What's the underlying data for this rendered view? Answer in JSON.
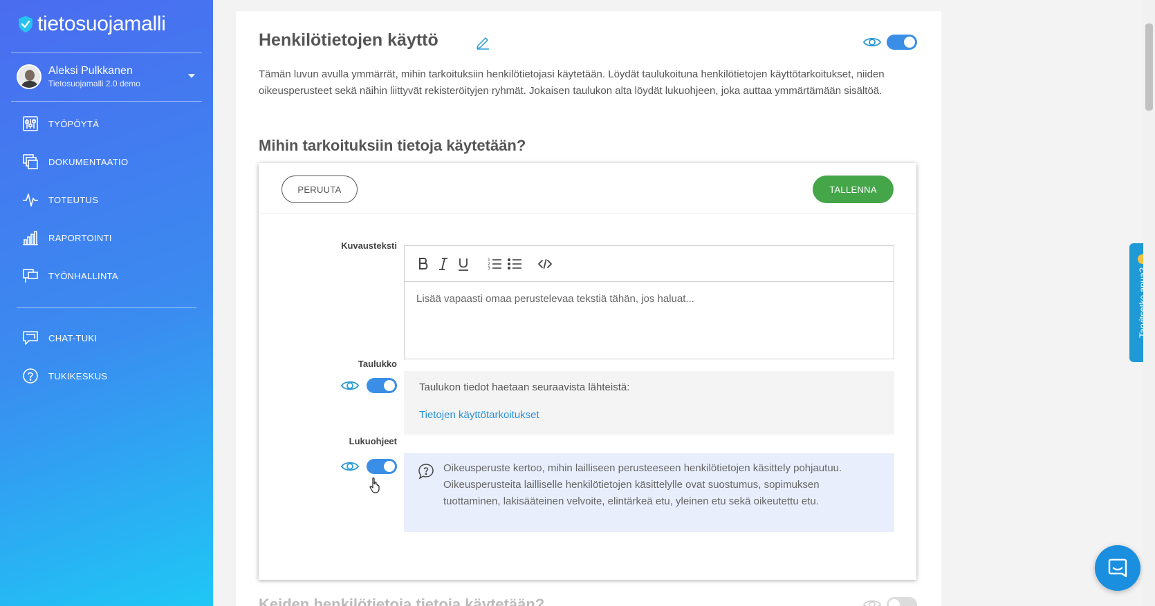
{
  "app": {
    "logo_text": "tietosuojamalli"
  },
  "user": {
    "name": "Aleksi Pulkkanen",
    "subtitle": "Tietosuojamalli 2.0 demo"
  },
  "nav": {
    "items": [
      {
        "label": "TYÖPÖYTÄ",
        "icon": "dashboard-icon"
      },
      {
        "label": "DOKUMENTAATIO",
        "icon": "documents-icon"
      },
      {
        "label": "TOTEUTUS",
        "icon": "pulse-icon"
      },
      {
        "label": "RAPORTOINTI",
        "icon": "bar-chart-icon"
      },
      {
        "label": "TYÖNHALLINTA",
        "icon": "task-icon"
      }
    ],
    "support": [
      {
        "label": "CHAT-TUKI",
        "icon": "chat-icon"
      },
      {
        "label": "TUKIKESKUS",
        "icon": "help-circle-icon"
      }
    ]
  },
  "page": {
    "title": "Henkilötietojen käyttö",
    "intro": "Tämän luvun avulla ymmärrät, mihin tarkoituksiin henkilötietojasi käytetään. Löydät taulukoituna henkilötietojen käyttötarkoitukset, niiden oikeusperusteet sekä näihin liittyvät rekisteröityjen ryhmät. Jokaisen taulukon alta löydät lukuohjeen, joka auttaa ymmärtämään sisältöä.",
    "section_title": "Mihin tarkoituksiin tietoja käytetään?",
    "next_section_title": "Keiden henkilötietoja tietoja käytetään?"
  },
  "editor": {
    "cancel_label": "PERUUTA",
    "save_label": "TALLENNA",
    "description_label": "Kuvausteksti",
    "description_placeholder": "Lisää vapaasti omaa perustelevaa tekstiä tähän, jos haluat...",
    "table_label": "Taulukko",
    "table_source_text": "Taulukon tiedot haetaan seuraavista lähteistä:",
    "table_source_link": "Tietojen käyttötarkoitukset",
    "instructions_label": "Lukuohjeet",
    "instructions_text": "Oikeusperuste kertoo, mihin lailliseen perusteeseen henkilötietojen käsittely pohjautuu. Oikeusperusteita lailliselle henkilötietojen käsittelylle ovat suostumus, sopimuksen tuottaminen, lakisääteinen velvoite, elintärkeä etu, yleinen etu sekä oikeutettu etu."
  },
  "help_tab": {
    "label": "Tarvitsetko apua?"
  },
  "colors": {
    "accent": "#3a8ee6",
    "save": "#45a549",
    "link": "#2a8fd6"
  }
}
